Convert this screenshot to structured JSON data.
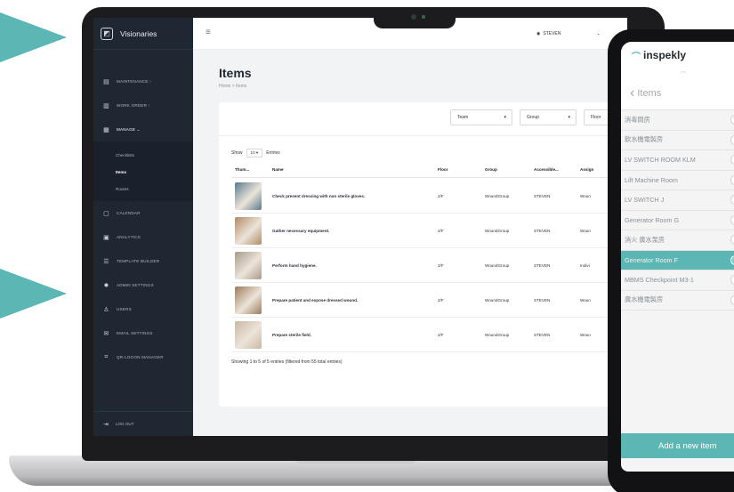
{
  "colors": {
    "accent": "#5cb7b4",
    "sidebar": "#1f2733"
  },
  "app": {
    "brand": "Visionaries",
    "nav": [
      {
        "label": "MAINTENANCE",
        "suffix": "›",
        "icon": "document-icon"
      },
      {
        "label": "WORK ORDER",
        "suffix": "›",
        "icon": "chat-icon"
      },
      {
        "label": "MANAGE",
        "suffix": "⌄",
        "icon": "grid-icon"
      }
    ],
    "sub_nav": [
      "Checklists",
      "Items",
      "Routes"
    ],
    "nav_bottom": [
      {
        "label": "CALENDAR",
        "icon": "calendar-icon"
      },
      {
        "label": "ANALYTICS",
        "icon": "analytics-icon"
      },
      {
        "label": "TEMPLATE BUILDER",
        "icon": "list-icon"
      },
      {
        "label": "ADMIN SETTINGS",
        "icon": "gear-icon"
      },
      {
        "label": "USERS",
        "icon": "users-icon"
      },
      {
        "label": "EMAIL SETTINGS",
        "icon": "mail-icon"
      },
      {
        "label": "QR-LOGON MANAGER",
        "icon": "qr-icon"
      }
    ],
    "logout": "LOG OUT",
    "user": "STEVEN",
    "page_title": "Items",
    "breadcrumb": "Home > Items",
    "filters": [
      "Team",
      "Group",
      "Floor"
    ],
    "show_prefix": "Show",
    "show_value": "10 ▾",
    "show_suffix": "Entries",
    "columns": [
      "Thum...",
      "Name",
      "Floor",
      "Group",
      "Accessible...",
      "Assign"
    ],
    "rows": [
      {
        "name": "Check present dressing with non sterile gloves.",
        "floor": "2/F",
        "group": "WoundGroup",
        "access": "STEVEN",
        "assign": "Woun",
        "thumb": "#5a7a8c"
      },
      {
        "name": "Gather necessary equipment.",
        "floor": "2/F",
        "group": "WoundGroup",
        "access": "STEVEN",
        "assign": "Woun",
        "thumb": "#b08a64"
      },
      {
        "name": "Perform hand hygiene.",
        "floor": "2/F",
        "group": "WoundGroup",
        "access": "STEVEN",
        "assign": "Indivi",
        "thumb": "#a89a8a"
      },
      {
        "name": "Prepare patient and expose dressed wound.",
        "floor": "2/F",
        "group": "WoundGroup",
        "access": "STEVEN",
        "assign": "Woun",
        "thumb": "#9c7a5c"
      },
      {
        "name": "Prepare sterile field.",
        "floor": "2/F",
        "group": "WoundGroup",
        "access": "STEVEN",
        "assign": "Woun",
        "thumb": "#c9b8a3"
      }
    ],
    "entries_note": "Showing 1 to 5 of 5 entries (filtered from 55 total entries)"
  },
  "tablet": {
    "brand": "inspekly",
    "back_label": "Items",
    "items": [
      "消毒間房",
      "飲水機電製房",
      "LV SWITCH ROOM KLM",
      "Lift Machine Room",
      "LV SWITCH J",
      "Generator Room G",
      "消火 廣水泵房",
      "Generator Room F",
      "MBMS Checkpoint M3-1",
      "廣水機電製房"
    ],
    "highlighted_index": 7,
    "add_button": "Add a new item"
  }
}
